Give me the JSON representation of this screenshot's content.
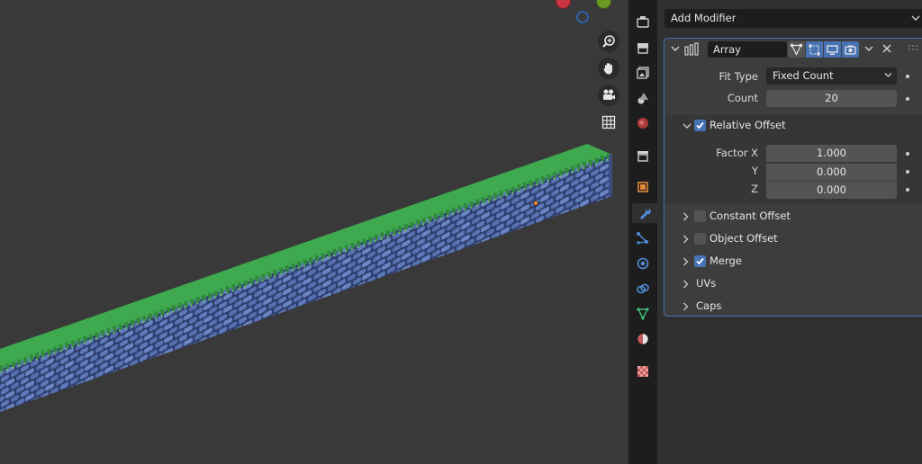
{
  "viewport": {
    "gizmo": {
      "x_axis_color": "#c6343f",
      "y_axis_color": "#6a9a23",
      "z_axis_color": "#2f5fa8"
    },
    "nav_buttons": [
      "zoom-icon",
      "hand-pan-icon",
      "camera-icon",
      "grid-icon"
    ],
    "object": {
      "grass_color": "#3fa94f",
      "stone_color": "#4f6aa8",
      "origin_color": "#f08a30"
    }
  },
  "tabs": [
    "tool-icon",
    "render-icon",
    "output-icon",
    "view-layer-icon",
    "scene-icon",
    "world-icon",
    "collection-icon",
    "object-icon",
    "modifier-icon",
    "particles-icon",
    "physics-icon",
    "constraints-icon",
    "data-icon",
    "material-icon",
    "texture-icon"
  ],
  "properties": {
    "add_modifier_label": "Add Modifier",
    "modifier": {
      "name": "Array",
      "fit_type_label": "Fit Type",
      "fit_type_value": "Fixed Count",
      "count_label": "Count",
      "count_value": "20",
      "relative_offset": {
        "label": "Relative Offset",
        "checked": true,
        "factor_x_label": "Factor X",
        "factor_x": "1.000",
        "y_label": "Y",
        "y": "0.000",
        "z_label": "Z",
        "z": "0.000"
      },
      "subpanels": [
        {
          "label": "Constant Offset",
          "has_checkbox": true,
          "checked": false
        },
        {
          "label": "Object Offset",
          "has_checkbox": true,
          "checked": false
        },
        {
          "label": "Merge",
          "has_checkbox": true,
          "checked": true
        },
        {
          "label": "UVs",
          "has_checkbox": false
        },
        {
          "label": "Caps",
          "has_checkbox": false
        }
      ]
    },
    "accent_color": "#4772b3"
  }
}
